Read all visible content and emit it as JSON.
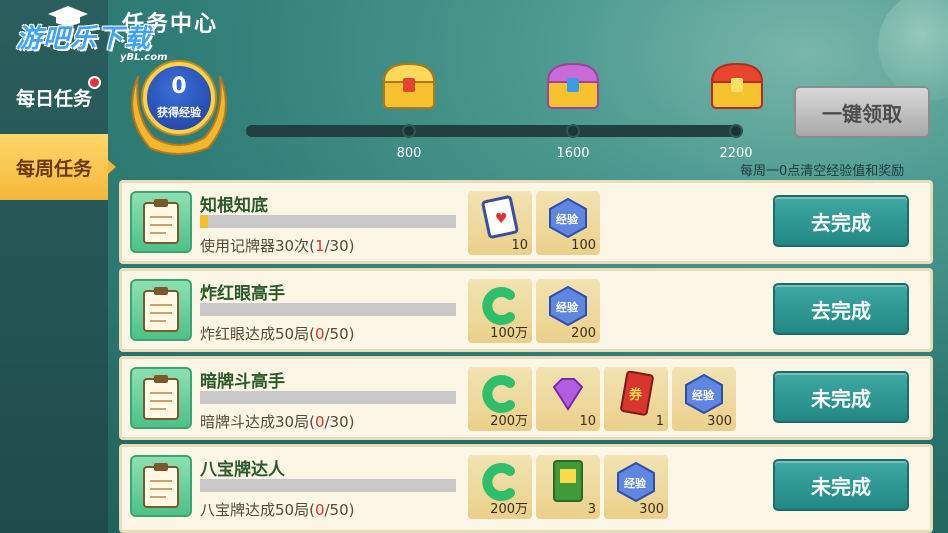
{
  "watermark": {
    "main": "游吧乐下载",
    "sub": "yBL.com"
  },
  "header": {
    "title": "任务中心"
  },
  "sidebar": {
    "tabs": [
      {
        "label": "每日任务",
        "badge": true
      },
      {
        "label": "每周任务",
        "active": true
      }
    ]
  },
  "exp": {
    "value": "0",
    "label": "获得经验"
  },
  "milestones": [
    {
      "value": "800"
    },
    {
      "value": "1600"
    },
    {
      "value": "2200"
    }
  ],
  "claim_button": "一键领取",
  "reset_note": "每周一0点清空经验值和奖励",
  "tasks": [
    {
      "name": "知根知底",
      "desc_prefix": "使用记牌器30次(",
      "current": "1",
      "desc_suffix": "/30)",
      "progress": 0.033,
      "rewards": [
        {
          "icon": "card-counter-icon",
          "amount": "10"
        },
        {
          "icon": "exp-badge-icon",
          "amount": "100"
        }
      ],
      "button": "去完成"
    },
    {
      "name": "炸红眼高手",
      "desc_prefix": "炸红眼达成50局(",
      "current": "0",
      "desc_suffix": "/50)",
      "progress": 0,
      "rewards": [
        {
          "icon": "coin-icon",
          "amount": "100万"
        },
        {
          "icon": "exp-badge-icon",
          "amount": "200"
        }
      ],
      "button": "去完成"
    },
    {
      "name": "暗牌斗高手",
      "desc_prefix": "暗牌斗达成30局(",
      "current": "0",
      "desc_suffix": "/30)",
      "progress": 0,
      "rewards": [
        {
          "icon": "coin-icon",
          "amount": "200万"
        },
        {
          "icon": "diamond-icon",
          "amount": "10"
        },
        {
          "icon": "ticket-icon",
          "amount": "1"
        },
        {
          "icon": "exp-badge-icon",
          "amount": "300"
        }
      ],
      "button": "未完成"
    },
    {
      "name": "八宝牌达人",
      "desc_prefix": "八宝牌达成50局(",
      "current": "0",
      "desc_suffix": "/50)",
      "progress": 0,
      "rewards": [
        {
          "icon": "coin-icon",
          "amount": "200万"
        },
        {
          "icon": "voucher-icon",
          "amount": "3"
        },
        {
          "icon": "exp-badge-icon",
          "amount": "300"
        }
      ],
      "button": "未完成"
    }
  ],
  "colors": {
    "accent": "#228884",
    "active_tab": "#f4b73a",
    "progress_red": "#d9332f"
  }
}
